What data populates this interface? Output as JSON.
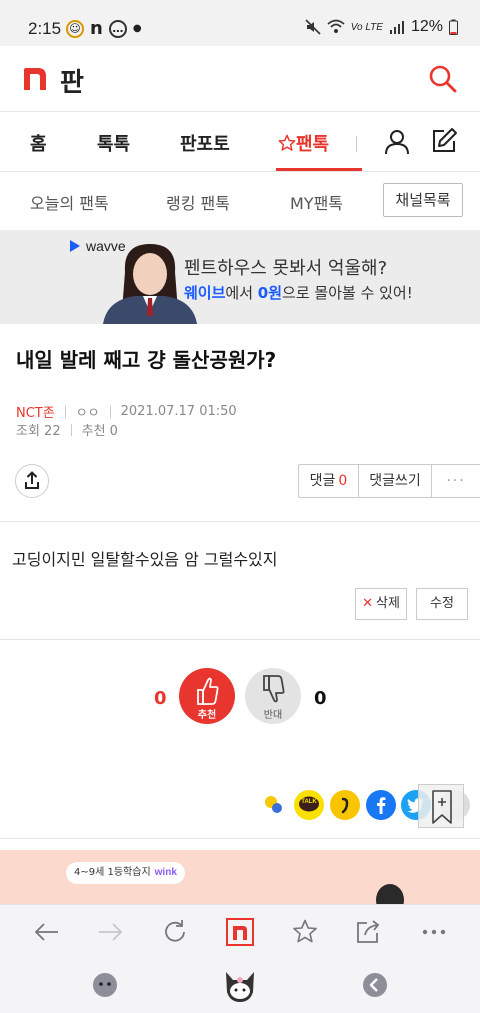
{
  "status_bar": {
    "time": "2:15",
    "battery": "12%",
    "network": "Vo LTE"
  },
  "header": {
    "logo_text": "판",
    "logo_color": "#e8352e"
  },
  "main_nav": {
    "items": [
      {
        "label": "홈"
      },
      {
        "label": "톡톡"
      },
      {
        "label": "판포토"
      },
      {
        "label": "팬톡",
        "active": true
      }
    ]
  },
  "sub_nav": {
    "items": [
      "오늘의 팬톡",
      "랭킹 팬톡",
      "MY팬톡"
    ],
    "channel_button": "채널목록"
  },
  "banner": {
    "brand": "wavve",
    "line1": "펜트하우스 못봐서 억울해?",
    "line2_pre": "웨이브",
    "line2_mid": "에서 ",
    "line2_bold": "0원",
    "line2_post": "으로 몰아볼 수 있어!"
  },
  "post": {
    "title": "내일 발레 째고 걍 돌산공원가?",
    "author": "NCT존",
    "nickname": "ㅇㅇ",
    "datetime": "2021.07.17 01:50",
    "views": "조회 22",
    "likes": "추천 0",
    "body": "고딩이지민 일탈할수있음 암 그럴수있지"
  },
  "actions": {
    "comment_label": "댓글",
    "comment_count": "0",
    "write_comment": "댓글쓰기",
    "more": "···",
    "delete": "삭제",
    "edit": "수정"
  },
  "votes": {
    "up_count": "0",
    "up_label": "추천",
    "down_label": "반대",
    "down_count": "0"
  },
  "social": {
    "kakao_talk_label": "TALK"
  },
  "ad2": {
    "text": "4~9세 1등학습지",
    "brand": "wink"
  },
  "colors": {
    "accent": "#e8352e",
    "wavve_blue": "#1b5cff",
    "kakao_yellow": "#f9e000",
    "facebook": "#1877f2",
    "twitter": "#1da1f2"
  }
}
